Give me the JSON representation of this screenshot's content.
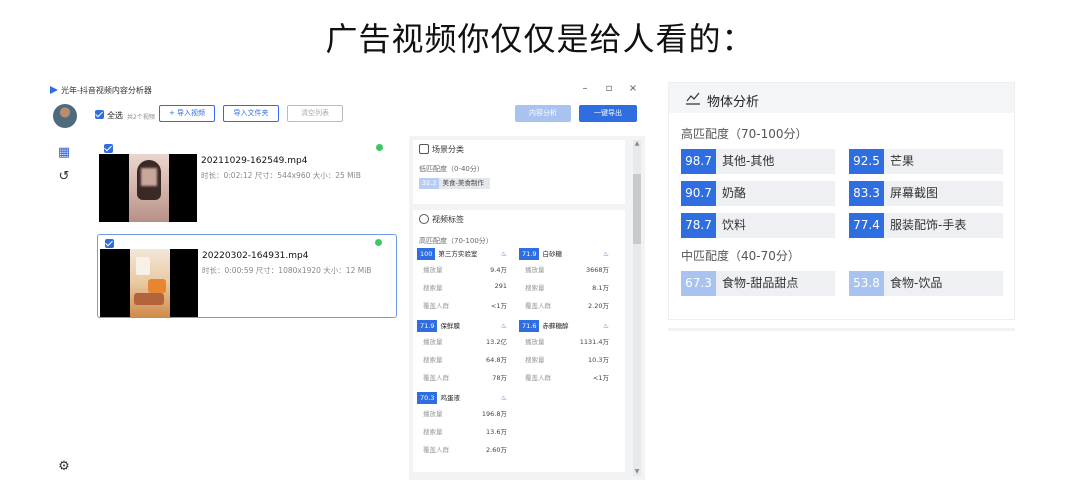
{
  "headline": "广告视频你仅仅是给人看的：",
  "app": {
    "title": "光年-抖音视频内容分析器",
    "window_controls": [
      "–",
      "▫",
      "×"
    ],
    "toolbar": {
      "select_all": "全选",
      "count": "共2个视频",
      "import_video": "+ 导入视频",
      "import_folder": "导入文件夹",
      "clear_list": "清空列表",
      "content_analysis": "内容分析",
      "export": "一键导出"
    },
    "videos": [
      {
        "name": "20211029-162549.mp4",
        "meta": "时长：0:02:12  尺寸：544x960  大小：25 MiB"
      },
      {
        "name": "20220302-164931.mp4",
        "meta": "时长：0:00:59  尺寸：1080x1920  大小：12 MiB"
      }
    ],
    "scene": {
      "title": "场景分类",
      "tier": "低匹配度（0-40分）",
      "tag_score": "32.2",
      "tag_name": "美食-美食制作"
    },
    "tags": {
      "title": "视频标签",
      "tier": "高匹配度（70-100分）",
      "row_labels": [
        "播放量",
        "搜索量",
        "覆盖人群"
      ],
      "items": [
        {
          "score": "100",
          "name": "第三方实验室",
          "values": [
            "9.4万",
            "291",
            "<1万"
          ]
        },
        {
          "score": "71.9",
          "name": "白砂糖",
          "values": [
            "3668万",
            "8.1万",
            "2.20万"
          ]
        },
        {
          "score": "71.9",
          "name": "保鲜膜",
          "values": [
            "13.2亿",
            "64.8万",
            "78万"
          ]
        },
        {
          "score": "71.6",
          "name": "赤藓糖醇",
          "values": [
            "1131.4万",
            "10.3万",
            "<1万"
          ]
        },
        {
          "score": "70.3",
          "name": "鸡蛋液",
          "values": [
            "196.8万",
            "13.6万",
            "2.60万"
          ]
        }
      ]
    }
  },
  "objects": {
    "title": "物体分析",
    "high_tier": "高匹配度（70-100分）",
    "high": [
      {
        "score": "98.7",
        "name": "其他-其他"
      },
      {
        "score": "92.5",
        "name": "芒果"
      },
      {
        "score": "90.7",
        "name": "奶酪"
      },
      {
        "score": "83.3",
        "name": "屏幕截图"
      },
      {
        "score": "78.7",
        "name": "饮料"
      },
      {
        "score": "77.4",
        "name": "服装配饰-手表"
      }
    ],
    "mid_tier": "中匹配度（40-70分）",
    "mid": [
      {
        "score": "67.3",
        "name": "食物-甜品甜点"
      },
      {
        "score": "53.8",
        "name": "食物-饮品"
      }
    ]
  }
}
